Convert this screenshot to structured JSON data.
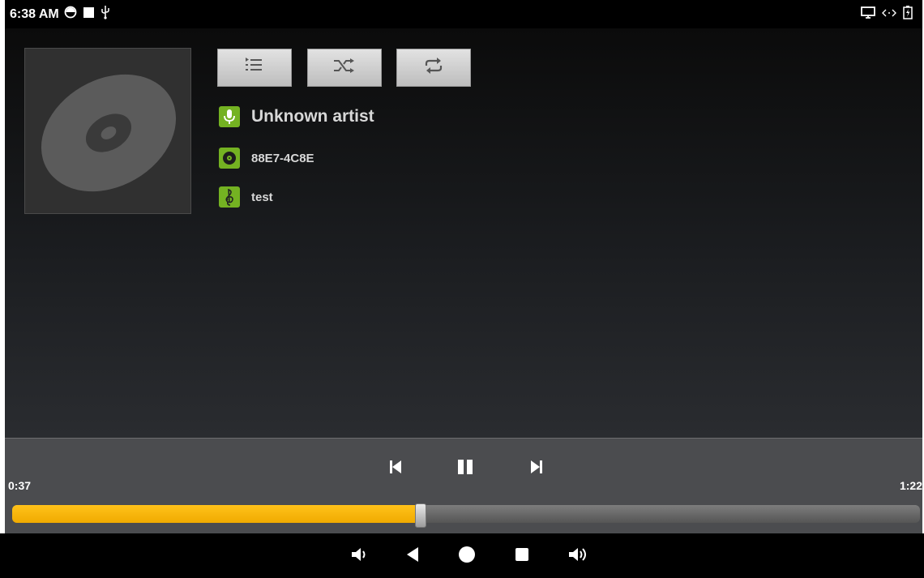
{
  "status_bar": {
    "time": "6:38 AM",
    "left_icons": [
      "clock-icon",
      "square-notification-icon",
      "usb-icon"
    ],
    "right_icons": [
      "cast-screen-icon",
      "data-sync-icon",
      "battery-charging-icon"
    ]
  },
  "toolbar": {
    "buttons": [
      "playlist-icon",
      "shuffle-icon",
      "repeat-icon"
    ]
  },
  "track": {
    "artist": "Unknown artist",
    "album": "88E7-4C8E",
    "title": "test"
  },
  "playback": {
    "elapsed": "0:37",
    "total": "1:22",
    "progress": 0.45,
    "state": "playing",
    "controls": [
      "previous-icon",
      "pause-icon",
      "next-icon"
    ]
  },
  "nav_bar": {
    "buttons": [
      "volume-down-icon",
      "back-icon",
      "home-icon",
      "recents-icon",
      "volume-up-icon"
    ]
  },
  "colors": {
    "accent": "#ffbd00",
    "icon_green": "#74b222",
    "controls_bg": "#4b4c4f"
  }
}
